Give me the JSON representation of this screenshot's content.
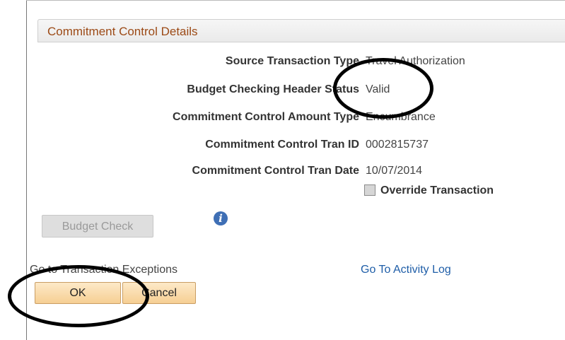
{
  "panel": {
    "title": "Commitment Control Details"
  },
  "details": [
    {
      "label": "Source Transaction Type",
      "value": "Travel Authorization"
    },
    {
      "label": "Budget Checking Header Status",
      "value": "Valid"
    },
    {
      "label": "Commitment Control Amount Type",
      "value": "Encumbrance"
    },
    {
      "label": "Commitment Control Tran ID",
      "value": "0002815737"
    },
    {
      "label": "Commitment Control Tran Date",
      "value": "10/07/2014"
    }
  ],
  "override": {
    "label": "Override Transaction",
    "checked": false
  },
  "budget_check_button": {
    "label": "Budget Check",
    "enabled": false
  },
  "info_icon": {
    "glyph": "i",
    "icon": "info-icon"
  },
  "links": {
    "exceptions": "Go to Transaction Exceptions",
    "activity_log": "Go To Activity Log"
  },
  "buttons": {
    "ok": "OK",
    "cancel": "Cancel"
  },
  "colors": {
    "header_text": "#9c4a16",
    "link": "#1f5ea8",
    "button_fill": "#f6cf93",
    "info_icon": "#3f6fb5"
  }
}
